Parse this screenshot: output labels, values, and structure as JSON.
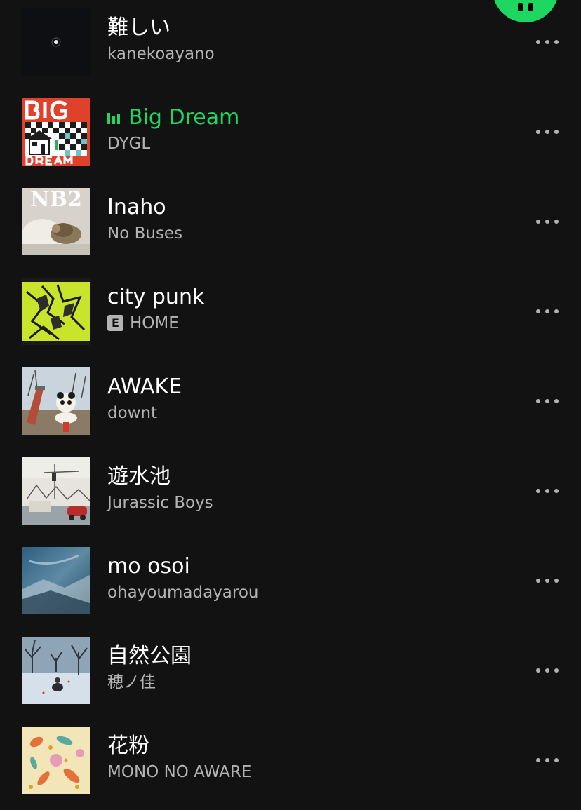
{
  "play_button": {
    "icon": "pause-icon",
    "color": "#1ed760"
  },
  "accent_color": "#1ed760",
  "tracks": [
    {
      "title": "難しい",
      "artist": "kanekoayano",
      "explicit": false,
      "playing": false
    },
    {
      "title": "Big Dream",
      "artist": "DYGL",
      "explicit": false,
      "playing": true
    },
    {
      "title": "Inaho",
      "artist": "No Buses",
      "explicit": false,
      "playing": false,
      "cover_text": "NB2"
    },
    {
      "title": "city punk",
      "artist": "HOME",
      "explicit": true,
      "explicit_label": "E",
      "playing": false
    },
    {
      "title": "AWAKE",
      "artist": "downt",
      "explicit": false,
      "playing": false
    },
    {
      "title": "遊水池",
      "artist": "Jurassic Boys",
      "explicit": false,
      "playing": false
    },
    {
      "title": "mo osoi",
      "artist": "ohayoumadayarou",
      "explicit": false,
      "playing": false
    },
    {
      "title": "自然公園",
      "artist": "穂ノ佳",
      "explicit": false,
      "playing": false
    },
    {
      "title": "花粉",
      "artist": "MONO NO AWARE",
      "explicit": false,
      "playing": false
    }
  ],
  "more_icon": "more-options-icon"
}
